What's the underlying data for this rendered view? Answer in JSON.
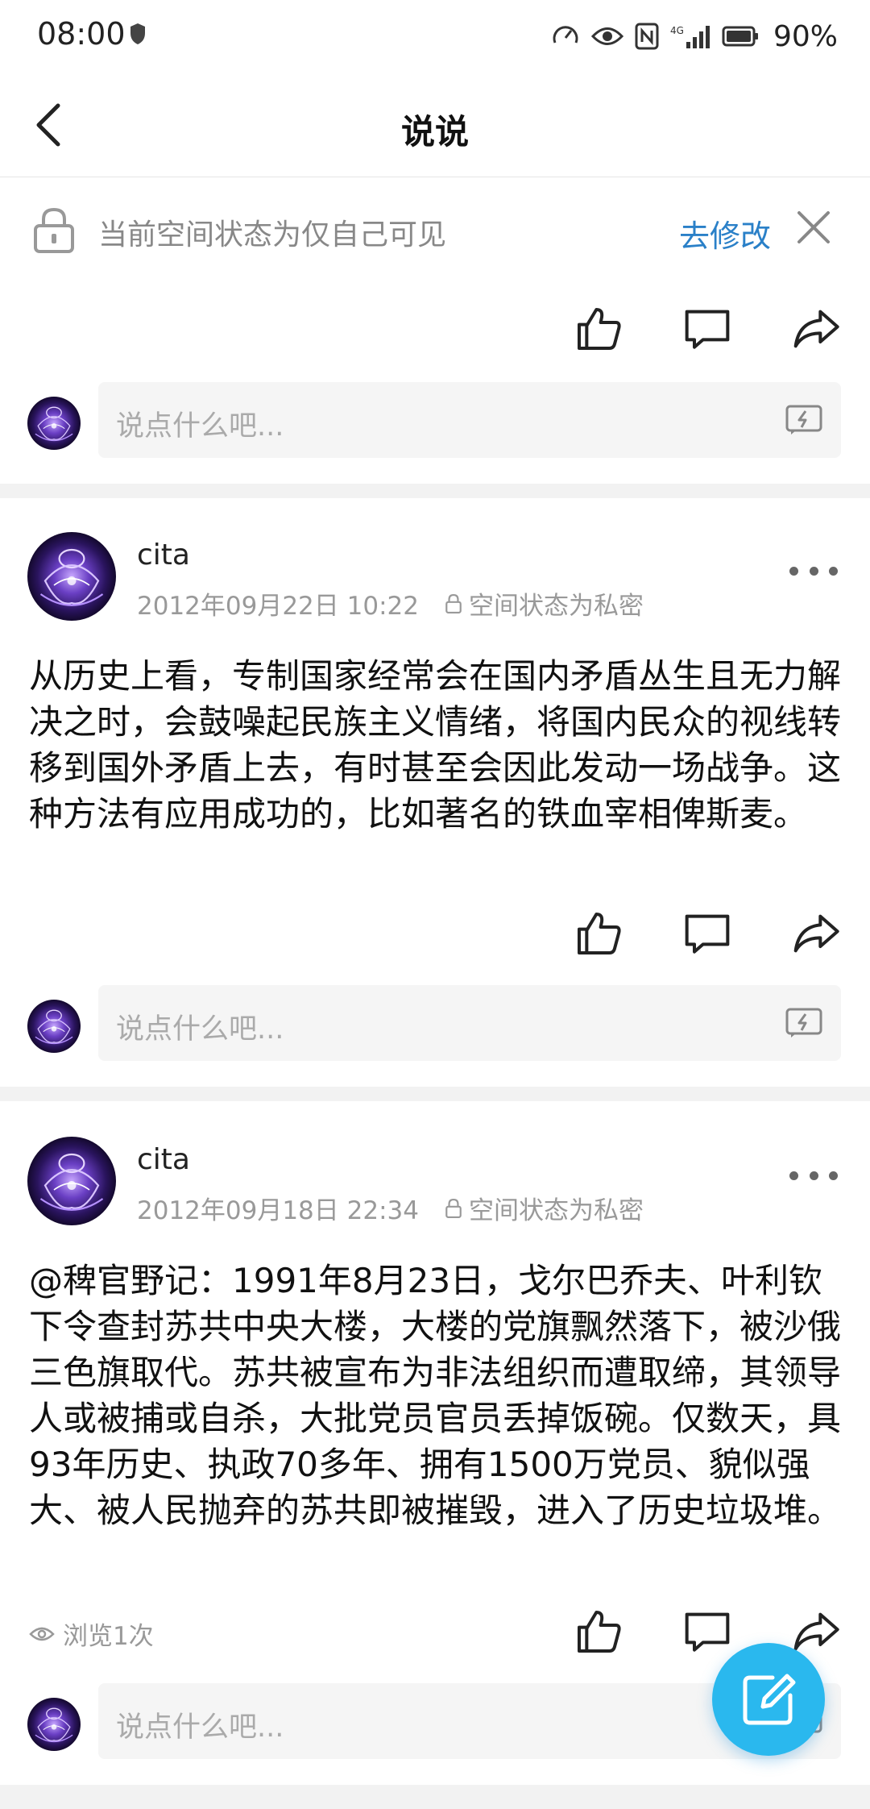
{
  "status_bar": {
    "time": "08:00",
    "battery_percent": "90%",
    "icons": [
      "shield-icon",
      "speed-icon",
      "eye-icon",
      "nfc-icon",
      "signal-icon",
      "battery-icon"
    ]
  },
  "header": {
    "title": "说说",
    "back_icon": "back-arrow-icon"
  },
  "notice": {
    "text": "当前空间状态为仅自己可见",
    "link": "去修改",
    "icons": [
      "lock-icon",
      "close-icon"
    ]
  },
  "comment_placeholder": "说点什么吧...",
  "posts": [
    {
      "author": "cita",
      "date": "2012年09月22日 10:22",
      "privacy": "空间状态为私密",
      "content": "从历史上看，专制国家经常会在国内矛盾丛生且无力解决之时，会鼓噪起民族主义情绪，将国内民众的视线转移到国外矛盾上去，有时甚至会因此发动一场战争。这种方法有应用成功的，比如著名的铁血宰相俾斯麦。"
    },
    {
      "author": "cita",
      "date": "2012年09月18日 22:34",
      "privacy": "空间状态为私密",
      "content": "@稗官野记：1991年8月23日，戈尔巴乔夫、叶利钦下令查封苏共中央大楼，大楼的党旗飘然落下，被沙俄三色旗取代。苏共被宣布为非法组织而遭取缔，其领导人或被捕或自杀，大批党员官员丢掉饭碗。仅数天，具93年历史、执政70多年、拥有1500万党员、貌似强大、被人民抛弃的苏共即被摧毁，进入了历史垃圾堆。",
      "views": "浏览1次"
    }
  ],
  "colors": {
    "link": "#2a80c8",
    "fab": "#2ab8ee",
    "muted": "#999999"
  }
}
